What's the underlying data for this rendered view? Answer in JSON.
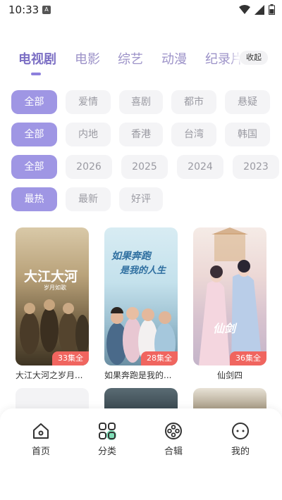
{
  "status": {
    "time": "10:33",
    "notify_letter": "A"
  },
  "top_tabs": {
    "items": [
      "电视剧",
      "电影",
      "综艺",
      "动漫",
      "纪录片"
    ],
    "active": "电视剧",
    "collapse_label": "收起"
  },
  "filters": {
    "genre": [
      "全部",
      "爱情",
      "喜剧",
      "都市",
      "悬疑"
    ],
    "region": [
      "全部",
      "内地",
      "香港",
      "台湾",
      "韩国"
    ],
    "year": [
      "全部",
      "2026",
      "2025",
      "2024",
      "2023"
    ],
    "sort": [
      "最热",
      "最新",
      "好评"
    ]
  },
  "cards": [
    {
      "title": "大江大河之岁月...",
      "episodes": "33集全",
      "poster_title": "大江大河",
      "poster_sub": "岁月如歌"
    },
    {
      "title": "如果奔跑是我的...",
      "episodes": "28集全",
      "poster_title": "如果奔跑",
      "poster_sub": "是我的人生"
    },
    {
      "title": "仙剑四",
      "episodes": "36集全",
      "poster_title": "仙剑",
      "poster_sub": ""
    }
  ],
  "bottom_nav": [
    {
      "label": "首页",
      "icon": "home-icon"
    },
    {
      "label": "分类",
      "icon": "category-icon"
    },
    {
      "label": "合辑",
      "icon": "collection-icon"
    },
    {
      "label": "我的",
      "icon": "profile-icon"
    }
  ],
  "colors": {
    "accent": "#9f96e4",
    "tab_active": "#7c6fc4",
    "badge": "#f0655f"
  }
}
